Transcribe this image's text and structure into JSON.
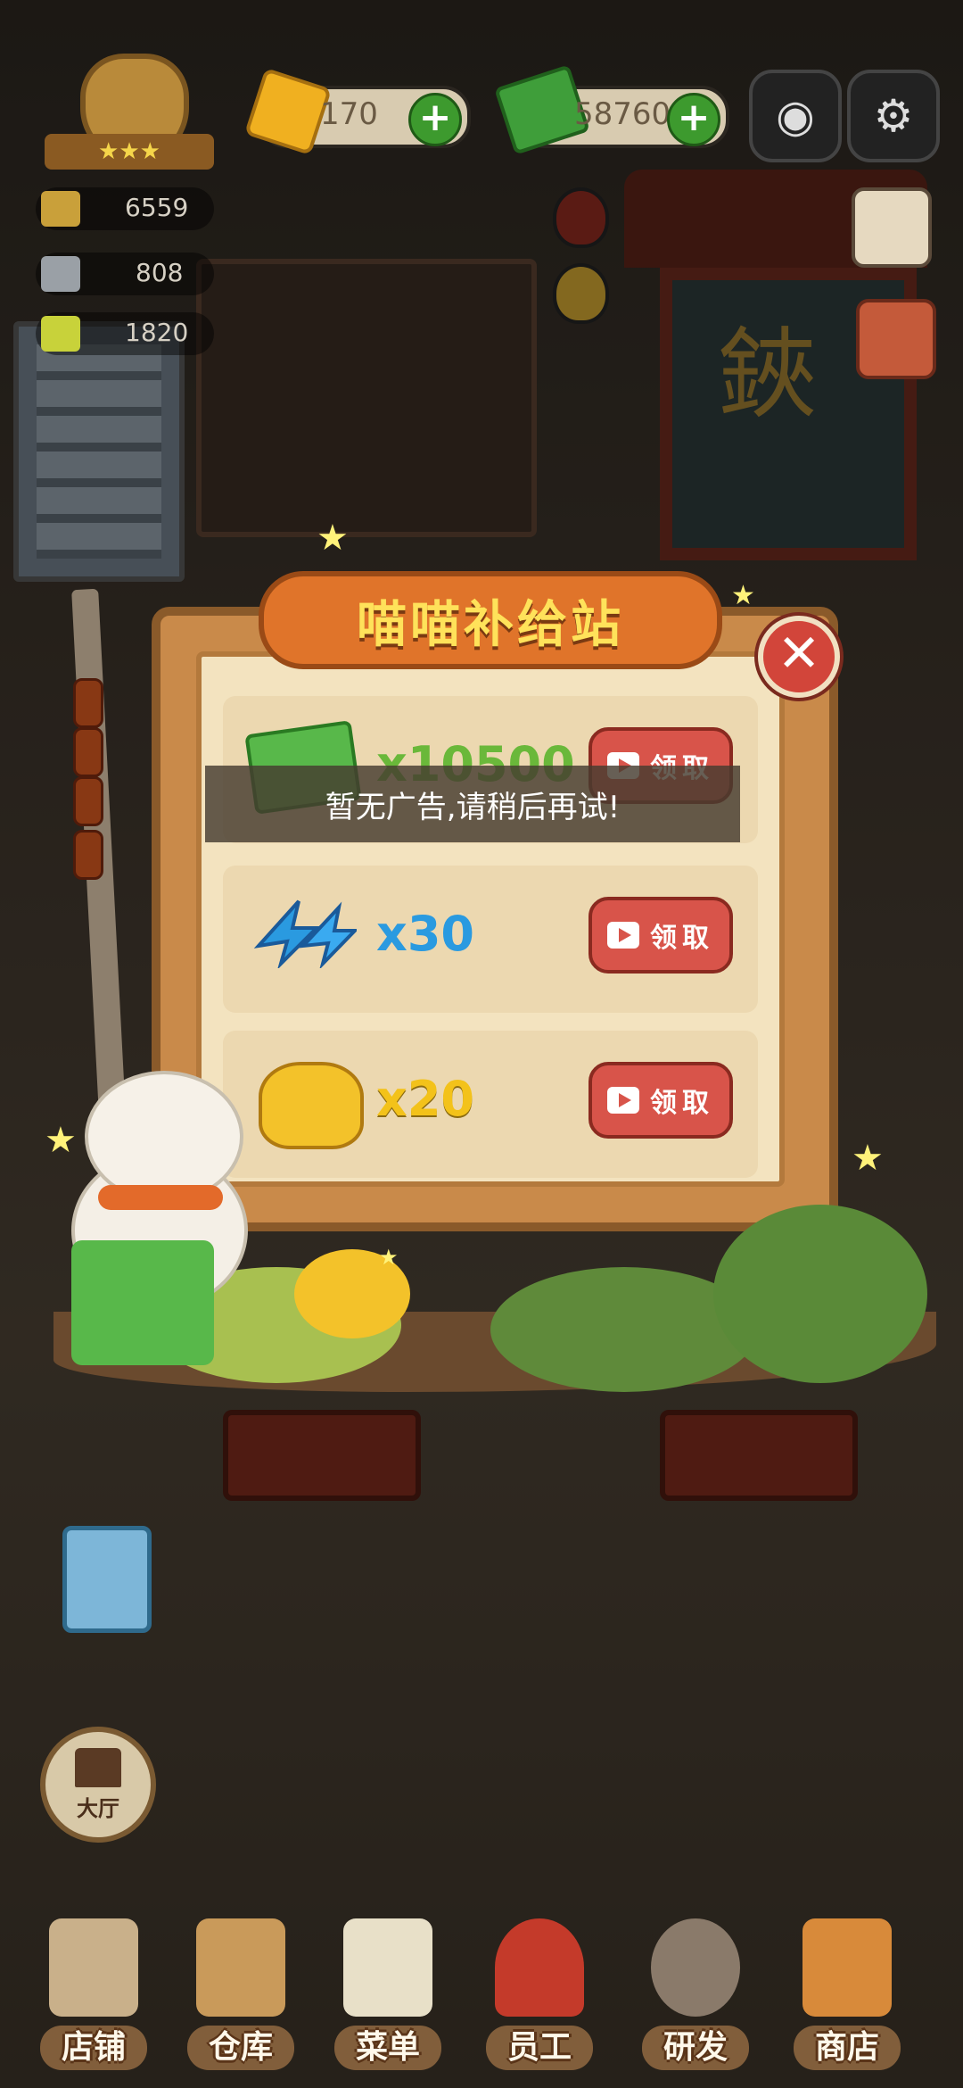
{
  "hud": {
    "gems": "170",
    "cash": "58760",
    "plus_symbol": "+",
    "camera_icon": "camera-icon",
    "settings_icon": "gear-icon",
    "badge_stars": "★★★"
  },
  "stats": [
    {
      "value": "6559",
      "icon": "pot-icon"
    },
    {
      "value": "808",
      "icon": "cloche-icon"
    },
    {
      "value": "1820",
      "icon": "book-icon"
    }
  ],
  "scene": {
    "door_glyph": "鋏"
  },
  "popup": {
    "title": "喵喵补给站",
    "close_symbol": "✕",
    "rewards": [
      {
        "icon": "cash-stack-icon",
        "amount": "x10500",
        "button": "领取",
        "color": "#6ab83a"
      },
      {
        "icon": "energy-bolt-icon",
        "amount": "x30",
        "button": "领取",
        "color": "#2a9ae0"
      },
      {
        "icon": "gold-nugget-icon",
        "amount": "x20",
        "button": "领取",
        "color": "#f3c21a"
      }
    ],
    "toast": "暂无广告,请稍后再试!"
  },
  "bottom": {
    "hall_label": "大厅",
    "nav": [
      {
        "label": "店铺",
        "icon": "shop-icon",
        "color": "#c9b08a"
      },
      {
        "label": "仓库",
        "icon": "warehouse-boxes-icon",
        "color": "#c99a5a"
      },
      {
        "label": "菜单",
        "icon": "menu-clipboard-icon",
        "color": "#e8e0c8"
      },
      {
        "label": "员工",
        "icon": "staff-chef-icon",
        "color": "#c43a2a"
      },
      {
        "label": "研发",
        "icon": "wok-icon",
        "color": "#8a7a6a"
      },
      {
        "label": "商店",
        "icon": "store-icon",
        "color": "#d88a3a"
      }
    ]
  },
  "colors": {
    "accent_red": "#d8544a",
    "title_yellow": "#ffe25a",
    "plus_green": "#3d9a2e"
  }
}
